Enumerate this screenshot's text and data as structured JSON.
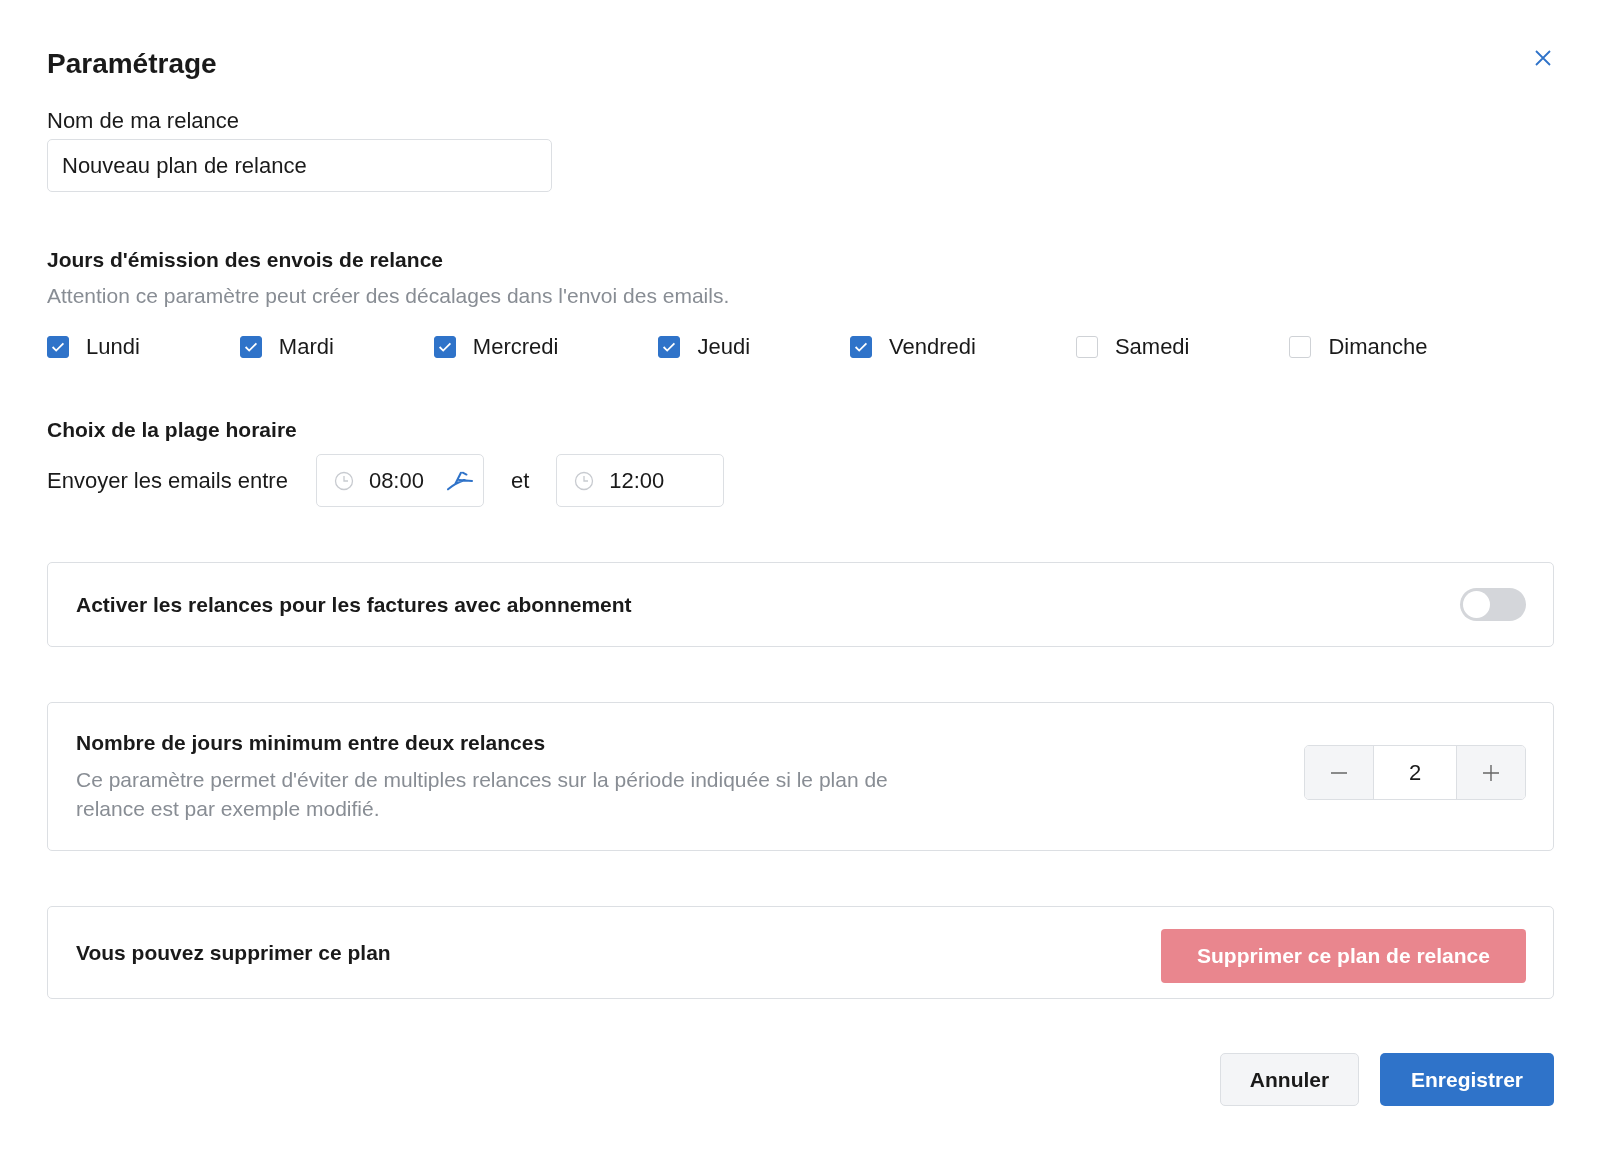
{
  "dialog": {
    "title": "Paramétrage"
  },
  "name_field": {
    "label": "Nom de ma relance",
    "value": "Nouveau plan de relance"
  },
  "days": {
    "heading": "Jours d'émission des envois de relance",
    "hint": "Attention ce paramètre peut créer des décalages dans l'envoi des emails.",
    "items": [
      {
        "label": "Lundi",
        "checked": true
      },
      {
        "label": "Mardi",
        "checked": true
      },
      {
        "label": "Mercredi",
        "checked": true
      },
      {
        "label": "Jeudi",
        "checked": true
      },
      {
        "label": "Vendredi",
        "checked": true
      },
      {
        "label": "Samedi",
        "checked": false
      },
      {
        "label": "Dimanche",
        "checked": false
      }
    ]
  },
  "time_range": {
    "heading": "Choix de la plage horaire",
    "label": "Envoyer les emails entre",
    "start": "08:00",
    "separator": "et",
    "end": "12:00"
  },
  "subscription": {
    "label": "Activer les relances pour les factures avec abonnement",
    "on": false
  },
  "min_days": {
    "title": "Nombre de jours minimum entre deux relances",
    "description": "Ce paramètre permet d'éviter de multiples relances sur la période indiquée si le plan de relance est par exemple modifié.",
    "value": "2"
  },
  "delete": {
    "label": "Vous pouvez supprimer ce plan",
    "button": "Supprimer ce plan de relance"
  },
  "buttons": {
    "cancel": "Annuler",
    "save": "Enregistrer"
  }
}
